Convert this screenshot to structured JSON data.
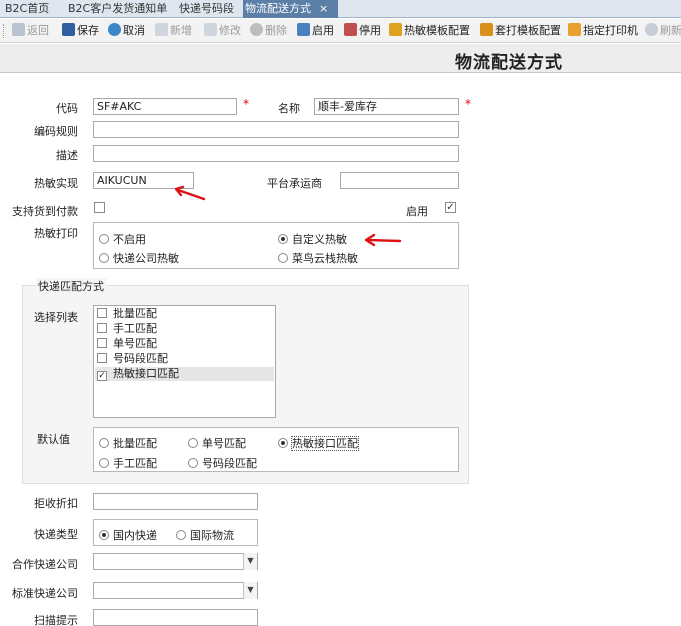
{
  "tabs": [
    {
      "label": "B2C首页"
    },
    {
      "label": "B2C客户发货通知单"
    },
    {
      "label": "快递号码段"
    },
    {
      "label": "物流配送方式",
      "close": "×"
    }
  ],
  "toolbar": {
    "back": "返回",
    "save": "保存",
    "cancel": "取消",
    "add": "新增",
    "edit": "修改",
    "delete": "删除",
    "enable": "启用",
    "disable": "停用",
    "thermal_template": "热敏模板配置",
    "overprint_template": "套打模板配置",
    "printer": "指定打印机",
    "refresh": "刷新"
  },
  "page_title": "物流配送方式",
  "form": {
    "code_label": "代码",
    "code_value": "SF#AKC",
    "name_label": "名称",
    "name_value": "顺丰-爱库存",
    "required_mark": "*",
    "rule_label": "编码规则",
    "desc_label": "描述",
    "thermal_impl_label": "热敏实现",
    "thermal_impl_value": "AIKUCUN",
    "carrier_label": "平台承运商",
    "cod_label": "支持货到付款",
    "enabled_label": "启用",
    "thermal_print_label": "热敏打印",
    "thermal_print_options": [
      "不启用",
      "自定义热敏",
      "快递公司热敏",
      "菜鸟云栈热敏"
    ],
    "thermal_print_selected": "自定义热敏"
  },
  "match": {
    "section_title": "快递匹配方式",
    "list_label": "选择列表",
    "list_items": [
      {
        "label": "批量匹配",
        "checked": false
      },
      {
        "label": "手工匹配",
        "checked": false
      },
      {
        "label": "单号匹配",
        "checked": false
      },
      {
        "label": "号码段匹配",
        "checked": false
      },
      {
        "label": "热敏接口匹配",
        "checked": true
      }
    ],
    "default_label": "默认值",
    "default_options": [
      "批量匹配",
      "单号匹配",
      "热敏接口匹配",
      "手工匹配",
      "号码段匹配"
    ],
    "default_selected": "热敏接口匹配"
  },
  "lower": {
    "discount_label": "拒收折扣",
    "express_type_label": "快递类型",
    "express_type_options": [
      "国内快递",
      "国际物流"
    ],
    "express_type_selected": "国内快递",
    "partner_label": "合作快递公司",
    "standard_label": "标准快递公司",
    "scan_label": "扫描提示"
  },
  "colors": {
    "accent_tab": "#5c7fa7",
    "required": "#ee0000",
    "annotation_arrow": "#dd1111"
  }
}
